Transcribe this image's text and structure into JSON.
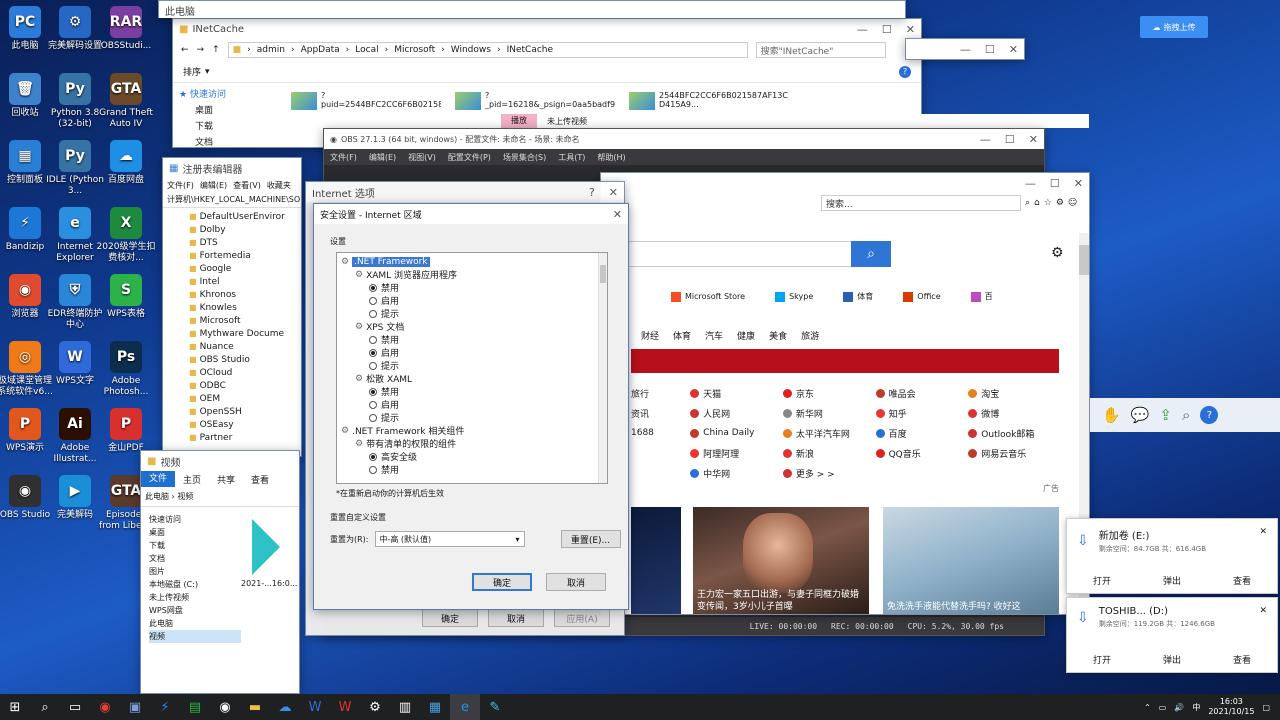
{
  "desktop_icons": [
    {
      "label": "此电脑",
      "color": "#2d7bd8",
      "glyph": "PC"
    },
    {
      "label": "完美解码设置",
      "color": "#2767c4",
      "glyph": "⚙"
    },
    {
      "label": "OBSStudi...",
      "color": "#7a3fa0",
      "glyph": "RAR"
    },
    {
      "label": "回收站",
      "color": "#3f82cc",
      "glyph": "🗑"
    },
    {
      "label": "Python 3.8 (32-bit)",
      "color": "#3672a4",
      "glyph": "Py"
    },
    {
      "label": "Grand Theft Auto IV",
      "color": "#6b4a2a",
      "glyph": "GTA"
    },
    {
      "label": "控制面板",
      "color": "#2a7fd4",
      "glyph": "▦"
    },
    {
      "label": "IDLE (Python 3...",
      "color": "#3672a4",
      "glyph": "Py"
    },
    {
      "label": "百度网盘",
      "color": "#1f8fe6",
      "glyph": "☁"
    },
    {
      "label": "Bandizip",
      "color": "#1c77d6",
      "glyph": "⚡"
    },
    {
      "label": "Internet Explorer",
      "color": "#2b8fe0",
      "glyph": "e"
    },
    {
      "label": "2020级学生扣费核对...",
      "color": "#1e8a3e",
      "glyph": "X"
    },
    {
      "label": "浏览器",
      "color": "#e04a2f",
      "glyph": "◉"
    },
    {
      "label": "EDR终端防护中心",
      "color": "#2a86d8",
      "glyph": "⛨"
    },
    {
      "label": "WPS表格",
      "color": "#2bb34a",
      "glyph": "S"
    },
    {
      "label": "极域课堂管理系统软件v6...",
      "color": "#f07a18",
      "glyph": "◎"
    },
    {
      "label": "WPS文字",
      "color": "#2f6ad8",
      "glyph": "W"
    },
    {
      "label": "Adobe Photosh...",
      "color": "#0c2d4d",
      "glyph": "Ps"
    },
    {
      "label": "WPS演示",
      "color": "#e2571d",
      "glyph": "P"
    },
    {
      "label": "Adobe Illustrat...",
      "color": "#2b0f00",
      "glyph": "Ai"
    },
    {
      "label": "金山PDF",
      "color": "#d8312d",
      "glyph": "P"
    },
    {
      "label": "OBS Studio",
      "color": "#303030",
      "glyph": "◉"
    },
    {
      "label": "完美解码",
      "color": "#1a8fd8",
      "glyph": "▶"
    },
    {
      "label": "Episodes from Liber...",
      "color": "#5a3a2a",
      "glyph": "GTA"
    }
  ],
  "explorer": {
    "title": "INetCache",
    "breadcrumb": [
      "admin",
      "AppData",
      "Local",
      "Microsoft",
      "Windows",
      "INetCache"
    ],
    "search_placeholder": "搜索\"INetCache\"",
    "sort_label": "排序",
    "quick_access": "快速访问",
    "nav": [
      "桌面",
      "下载",
      "文档"
    ],
    "files": [
      "?puid=2544BFC2CC6F6B021587AF13C",
      "?_pid=16218&_psign=0aa5badf92527f7732e22463d6fa4dbc&...",
      "2544BFC2CC6F6B021587AF13C D415A9..."
    ]
  },
  "explorer_top_title": "此电脑",
  "regedit": {
    "title": "注册表编辑器",
    "menu": [
      "文件(F)",
      "编辑(E)",
      "查看(V)",
      "收藏夹"
    ],
    "path": "计算机\\HKEY_LOCAL_MACHINE\\SO",
    "keys": [
      "DefaultUserEnviror",
      "Dolby",
      "DTS",
      "Fortemedia",
      "Google",
      "Intel",
      "Khronos",
      "Knowles",
      "Microsoft",
      "Mythware Docume",
      "Nuance",
      "OBS Studio",
      "OCloud",
      "ODBC",
      "OEM",
      "OpenSSH",
      "OSEasy",
      "Partner"
    ]
  },
  "obs": {
    "title": "OBS 27.1.3 (64 bit, windows) - 配置文件: 未命名 - 场景: 未命名",
    "menu": [
      "文件(F)",
      "编辑(E)",
      "视图(V)",
      "配置文件(P)",
      "场景集合(S)",
      "工具(T)",
      "帮助(H)"
    ],
    "status": {
      "live": "LIVE: 00:00:00",
      "rec": "REC: 00:00:00",
      "cpu": "CPU: 5.2%, 30.00 fps"
    }
  },
  "top_tabs": {
    "active": "播放",
    "inactive": "未上传视频"
  },
  "browser": {
    "search_placeholder": "搜索...",
    "shortcuts": [
      "Microsoft Store",
      "Skype",
      "体育",
      "Office",
      "百"
    ],
    "nav": [
      "财经",
      "体育",
      "汽车",
      "健康",
      "美食",
      "旅游"
    ],
    "links": [
      [
        "旅行",
        "天猫",
        "京东",
        "唯品会",
        "淘宝"
      ],
      [
        "资讯",
        "人民网",
        "新华网",
        "知乎",
        "微博"
      ],
      [
        "1688",
        "China Daily",
        "太平洋汽车网",
        "百度",
        "Outlook邮箱"
      ],
      [
        "",
        "阿理阿理",
        "新浪",
        "QQ音乐",
        "网易云音乐"
      ],
      [
        "",
        "中华网",
        "更多 > >",
        "",
        ""
      ]
    ],
    "ad_label": "广告",
    "news": [
      {
        "caption": "王力宏一家五口出游，与妻子同框力破婚变传闻，3岁小儿子首曝"
      },
      {
        "caption": "免洗洗手液能代替洗手吗? 收好这"
      }
    ]
  },
  "internet_options": {
    "title": "Internet 选项",
    "ok": "确定",
    "cancel": "取消",
    "apply": "应用(A)"
  },
  "security": {
    "title": "安全设置 - Internet 区域",
    "settings_label": "设置",
    "tree": [
      {
        "level": 0,
        "type": "cat",
        "label": ".NET Framework",
        "selected": true
      },
      {
        "level": 1,
        "type": "cat",
        "label": "XAML 浏览器应用程序"
      },
      {
        "level": 2,
        "type": "radio",
        "label": "禁用",
        "on": true
      },
      {
        "level": 2,
        "type": "radio",
        "label": "启用"
      },
      {
        "level": 2,
        "type": "radio",
        "label": "提示"
      },
      {
        "level": 1,
        "type": "cat",
        "label": "XPS 文档"
      },
      {
        "level": 2,
        "type": "radio",
        "label": "禁用"
      },
      {
        "level": 2,
        "type": "radio",
        "label": "启用",
        "on": true
      },
      {
        "level": 2,
        "type": "radio",
        "label": "提示"
      },
      {
        "level": 1,
        "type": "cat",
        "label": "松散 XAML"
      },
      {
        "level": 2,
        "type": "radio",
        "label": "禁用",
        "on": true
      },
      {
        "level": 2,
        "type": "radio",
        "label": "启用"
      },
      {
        "level": 2,
        "type": "radio",
        "label": "提示"
      },
      {
        "level": 0,
        "type": "cat",
        "label": ".NET Framework 相关组件"
      },
      {
        "level": 1,
        "type": "cat",
        "label": "带有清单的权限的组件"
      },
      {
        "level": 2,
        "type": "radio",
        "label": "高安全级",
        "on": true
      },
      {
        "level": 2,
        "type": "radio",
        "label": "禁用"
      }
    ],
    "note": "*在重新启动你的计算机后生效",
    "reset_title": "重置自定义设置",
    "reset_to_label": "重置为(R):",
    "reset_value": "中-高 (默认值)",
    "reset_button": "重置(E)...",
    "ok": "确定",
    "cancel": "取消"
  },
  "explorer2": {
    "title": "视频",
    "tabs": [
      "文件",
      "主页",
      "共享",
      "查看"
    ],
    "path": "此电脑 › 视频",
    "nav": [
      "快速访问",
      "桌面",
      "下载",
      "文档",
      "图片",
      "本地磁盘 (C:)",
      "未上传视频",
      "WPS网盘",
      "此电脑",
      "视频"
    ],
    "file_label": "2021-...16:0..."
  },
  "baidu_upload": "拖拽上传",
  "drives": [
    {
      "name": "新加卷 (E:)",
      "space": "剩余空间：84.7GB  共：616.4GB",
      "actions": [
        "打开",
        "弹出",
        "查看"
      ]
    },
    {
      "name": "TOSHIB... (D:)",
      "space": "剩余空间：119.2GB  共：1246.6GB",
      "actions": [
        "打开",
        "弹出",
        "查看"
      ]
    }
  ],
  "tray": {
    "time": "16:03",
    "date": "2021/10/15",
    "lang": "中"
  }
}
